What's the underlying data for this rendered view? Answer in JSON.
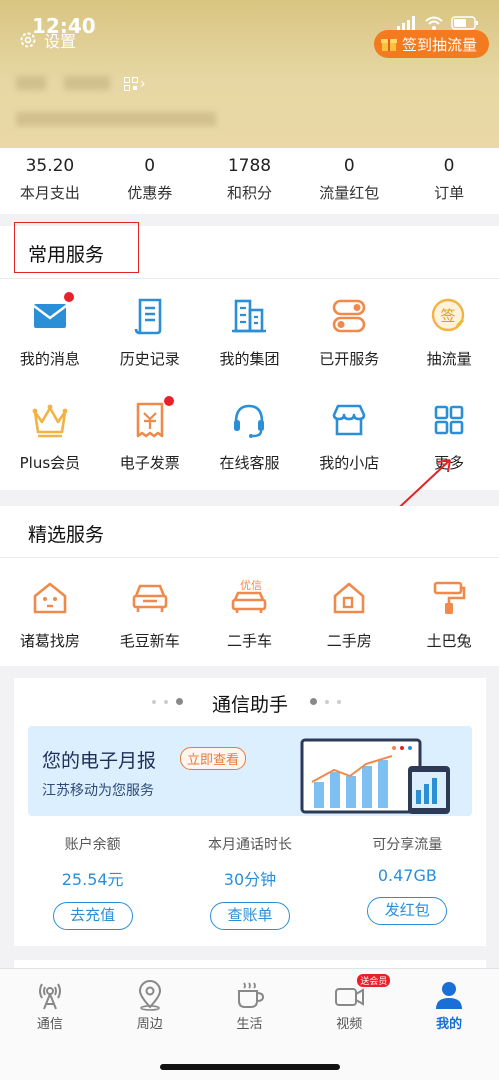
{
  "status": {
    "time": "12:40"
  },
  "header": {
    "settings_label": "设置",
    "sign_label": "签到抽流量"
  },
  "stats": [
    {
      "value": "35.20",
      "label": "本月支出"
    },
    {
      "value": "0",
      "label": "优惠券"
    },
    {
      "value": "1788",
      "label": "和积分"
    },
    {
      "value": "0",
      "label": "流量红包"
    },
    {
      "value": "0",
      "label": "订单"
    }
  ],
  "common": {
    "title": "常用服务",
    "items": [
      {
        "label": "我的消息",
        "icon": "envelope-icon"
      },
      {
        "label": "历史记录",
        "icon": "document-icon"
      },
      {
        "label": "我的集团",
        "icon": "building-icon"
      },
      {
        "label": "已开服务",
        "icon": "toggle-icon"
      },
      {
        "label": "抽流量",
        "icon": "sign-badge-icon"
      },
      {
        "label": "Plus会员",
        "icon": "crown-icon"
      },
      {
        "label": "电子发票",
        "icon": "invoice-icon"
      },
      {
        "label": "在线客服",
        "icon": "headset-icon"
      },
      {
        "label": "我的小店",
        "icon": "shop-icon"
      },
      {
        "label": "更多",
        "icon": "grid-icon"
      }
    ]
  },
  "featured": {
    "title": "精选服务",
    "items": [
      {
        "label": "诸葛找房",
        "icon": "house-icon"
      },
      {
        "label": "毛豆新车",
        "icon": "car-icon"
      },
      {
        "label": "二手车",
        "icon": "used-car-icon",
        "badge": "优信"
      },
      {
        "label": "二手房",
        "icon": "home-icon"
      },
      {
        "label": "土巴兔",
        "icon": "paint-roller-icon"
      }
    ]
  },
  "assistant": {
    "title": "通信助手",
    "banner_title": "您的电子月报",
    "banner_tag": "立即查看",
    "banner_sub": "江苏移动为您服务",
    "accounts": [
      {
        "label": "账户余额",
        "value": "25.54元",
        "button": "去充值"
      },
      {
        "label": "本月通话时长",
        "value": "30分钟",
        "button": "查账单"
      },
      {
        "label": "可分享流量",
        "value": "0.47GB",
        "button": "发红包"
      }
    ]
  },
  "tabs": [
    {
      "label": "通信",
      "icon": "signal-tower-icon"
    },
    {
      "label": "周边",
      "icon": "location-pin-icon"
    },
    {
      "label": "生活",
      "icon": "coffee-cup-icon"
    },
    {
      "label": "视频",
      "icon": "video-camera-icon",
      "badge": "送会员"
    },
    {
      "label": "我的",
      "icon": "person-icon",
      "active": true
    }
  ],
  "colors": {
    "accent_blue": "#2b8fd8",
    "accent_orange": "#f37a1f",
    "header_gold": "#d9c582",
    "highlight_red": "#e42424"
  }
}
